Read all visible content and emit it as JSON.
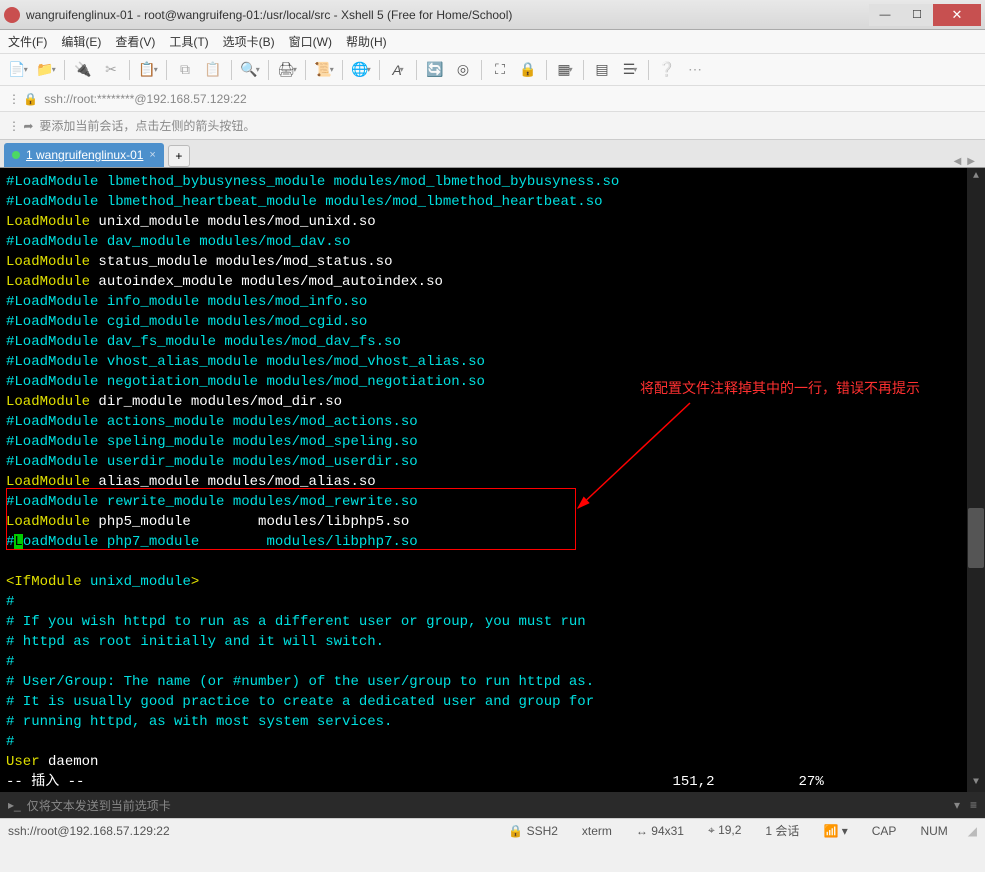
{
  "window": {
    "title": "wangruifenglinux-01 - root@wangruifeng-01:/usr/local/src - Xshell 5 (Free for Home/School)"
  },
  "menu": {
    "file": "文件(F)",
    "edit": "编辑(E)",
    "view": "查看(V)",
    "tools": "工具(T)",
    "options": "选项卡(B)",
    "window": "窗口(W)",
    "help": "帮助(H)"
  },
  "addressbar": {
    "text": "ssh://root:********@192.168.57.129:22"
  },
  "hintbar": {
    "text": "要添加当前会话，点击左侧的箭头按钮。"
  },
  "tab": {
    "label": "1 wangruifenglinux-01"
  },
  "terminal": {
    "lines": [
      {
        "t": "c",
        "s": "#LoadModule lbmethod_bybusyness_module modules/mod_lbmethod_bybusyness.so"
      },
      {
        "t": "c",
        "s": "#LoadModule lbmethod_heartbeat_module modules/mod_lbmethod_heartbeat.so"
      },
      {
        "t": "mix",
        "p": [
          {
            "c": "y",
            "s": "LoadModule"
          },
          {
            "c": "w",
            "s": " unixd_module modules/mod_unixd.so"
          }
        ]
      },
      {
        "t": "c",
        "s": "#LoadModule dav_module modules/mod_dav.so"
      },
      {
        "t": "mix",
        "p": [
          {
            "c": "y",
            "s": "LoadModule"
          },
          {
            "c": "w",
            "s": " status_module modules/mod_status.so"
          }
        ]
      },
      {
        "t": "mix",
        "p": [
          {
            "c": "y",
            "s": "LoadModule"
          },
          {
            "c": "w",
            "s": " autoindex_module modules/mod_autoindex.so"
          }
        ]
      },
      {
        "t": "c",
        "s": "#LoadModule info_module modules/mod_info.so"
      },
      {
        "t": "c",
        "s": "#LoadModule cgid_module modules/mod_cgid.so"
      },
      {
        "t": "c",
        "s": "#LoadModule dav_fs_module modules/mod_dav_fs.so"
      },
      {
        "t": "c",
        "s": "#LoadModule vhost_alias_module modules/mod_vhost_alias.so"
      },
      {
        "t": "c",
        "s": "#LoadModule negotiation_module modules/mod_negotiation.so"
      },
      {
        "t": "mix",
        "p": [
          {
            "c": "y",
            "s": "LoadModule"
          },
          {
            "c": "w",
            "s": " dir_module modules/mod_dir.so"
          }
        ]
      },
      {
        "t": "c",
        "s": "#LoadModule actions_module modules/mod_actions.so"
      },
      {
        "t": "c",
        "s": "#LoadModule speling_module modules/mod_speling.so"
      },
      {
        "t": "c",
        "s": "#LoadModule userdir_module modules/mod_userdir.so"
      },
      {
        "t": "mix",
        "p": [
          {
            "c": "y",
            "s": "LoadModule"
          },
          {
            "c": "w",
            "s": " alias_module modules/mod_alias.so"
          }
        ]
      },
      {
        "t": "c",
        "s": "#LoadModule rewrite_module modules/mod_rewrite.so"
      },
      {
        "t": "mix",
        "p": [
          {
            "c": "y",
            "s": "LoadModule"
          },
          {
            "c": "w",
            "s": " php5_module        modules/libphp5.so"
          }
        ]
      },
      {
        "t": "mix",
        "p": [
          {
            "c": "c",
            "s": "#"
          },
          {
            "c": "cur",
            "s": "L"
          },
          {
            "c": "c",
            "s": "oadModule php7_module        modules/libphp7.so"
          }
        ]
      },
      {
        "t": "blank"
      },
      {
        "t": "mix",
        "p": [
          {
            "c": "y",
            "s": "<IfModule"
          },
          {
            "c": "c",
            "s": " unixd_module"
          },
          {
            "c": "y",
            "s": ">"
          }
        ]
      },
      {
        "t": "c",
        "s": "#"
      },
      {
        "t": "c",
        "s": "# If you wish httpd to run as a different user or group, you must run"
      },
      {
        "t": "c",
        "s": "# httpd as root initially and it will switch."
      },
      {
        "t": "c",
        "s": "#"
      },
      {
        "t": "c",
        "s": "# User/Group: The name (or #number) of the user/group to run httpd as."
      },
      {
        "t": "c",
        "s": "# It is usually good practice to create a dedicated user and group for"
      },
      {
        "t": "c",
        "s": "# running httpd, as with most system services."
      },
      {
        "t": "c",
        "s": "#"
      },
      {
        "t": "mix",
        "p": [
          {
            "c": "y",
            "s": "User"
          },
          {
            "c": "w",
            "s": " daemon"
          }
        ]
      }
    ],
    "modeline_left": "-- 插入 --",
    "modeline_pos": "151,2",
    "modeline_pct": "27%",
    "annotation": "将配置文件注释掉其中的一行，错误不再提示"
  },
  "sendbar": {
    "text": "仅将文本发送到当前选项卡"
  },
  "status": {
    "conn": "ssh://root@192.168.57.129:22",
    "proto": "SSH2",
    "term": "xterm",
    "size": "94x31",
    "pos": "19,2",
    "sessions": "1 会话",
    "cap": "CAP",
    "num": "NUM"
  }
}
